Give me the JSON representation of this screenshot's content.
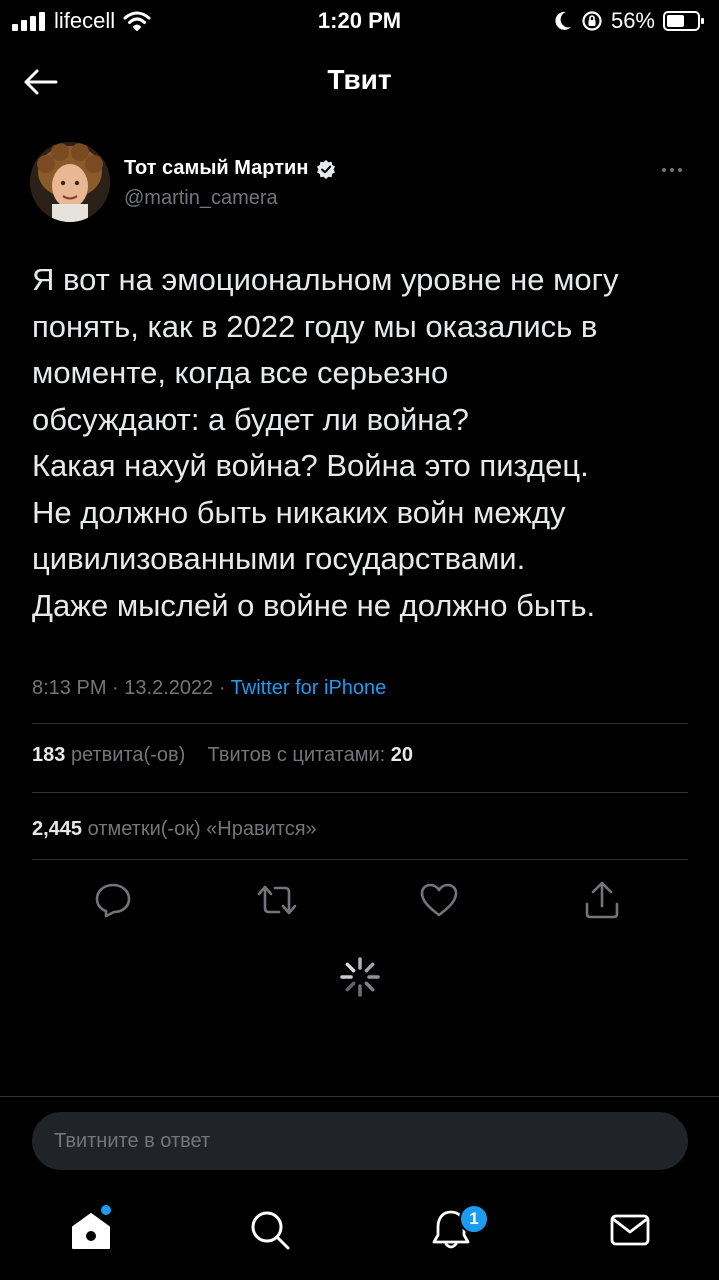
{
  "status_bar": {
    "carrier": "lifecell",
    "time": "1:20 PM",
    "battery": "56%"
  },
  "header": {
    "title": "Твит",
    "back_icon": "arrow-left-icon"
  },
  "author": {
    "name": "Тот самый Мартин",
    "handle": "@martin_camera",
    "verified": true
  },
  "tweet": {
    "text": "Я вот на эмоциональном уровне не могу\nпонять, как в 2022 году мы оказались в\nмоменте, когда все серьезно\nобсуждают: а будет ли война?\nКакая нахуй война? Война это пиздец.\nНе должно быть никаких войн между\nцивилизованными государствами.\nДаже мыслей о войне не должно быть.",
    "time": "8:13 PM",
    "date": "13.2.2022",
    "source": "Twitter for iPhone"
  },
  "stats": {
    "retweets_count": "183",
    "retweets_label": "ретвита(-ов)",
    "quotes_label": "Твитов с цитатами:",
    "quotes_count": "20",
    "likes_count": "2,445",
    "likes_label": "отметки(-ок) «Нравится»"
  },
  "actions": [
    "reply-icon",
    "retweet-icon",
    "like-icon",
    "share-icon"
  ],
  "reply": {
    "placeholder": "Твитните в ответ"
  },
  "nav": {
    "items": [
      "home-icon",
      "search-icon",
      "notifications-icon",
      "messages-icon"
    ],
    "notifications_badge": "1"
  },
  "colors": {
    "background": "#000000",
    "accent": "#1d9bf0",
    "secondary_text": "#71767b",
    "divider": "#2f3336"
  }
}
